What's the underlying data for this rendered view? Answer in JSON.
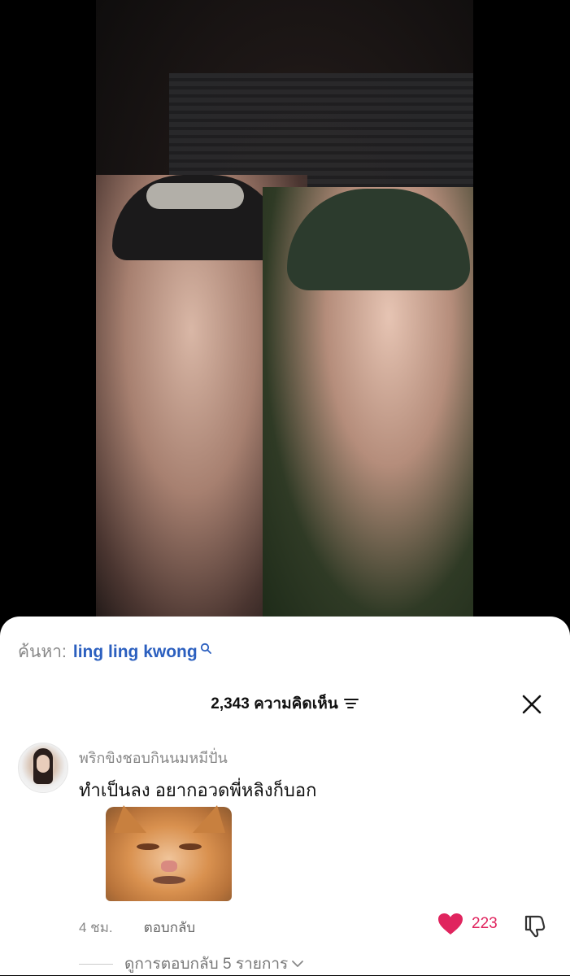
{
  "search": {
    "prefix": "ค้นหา:",
    "term": "ling ling kwong"
  },
  "comments_header": {
    "count_label": "2,343 ความคิดเห็น"
  },
  "comment": {
    "username": "พริกขิงชอบกินนมหมีปั่น",
    "text": "ทำเป็นลง อยากอวดพี่หลิงก็บอก",
    "time": "4 ชม.",
    "reply_label": "ตอบกลับ",
    "like_count": "223",
    "view_replies_label": "ดูการตอบกลับ 5 รายการ"
  },
  "colors": {
    "link": "#2b5fbf",
    "like": "#e0245e"
  },
  "icons": [
    "search-icon",
    "sort-icon",
    "close-icon",
    "heart-icon",
    "dislike-icon",
    "chevron-down-icon"
  ]
}
